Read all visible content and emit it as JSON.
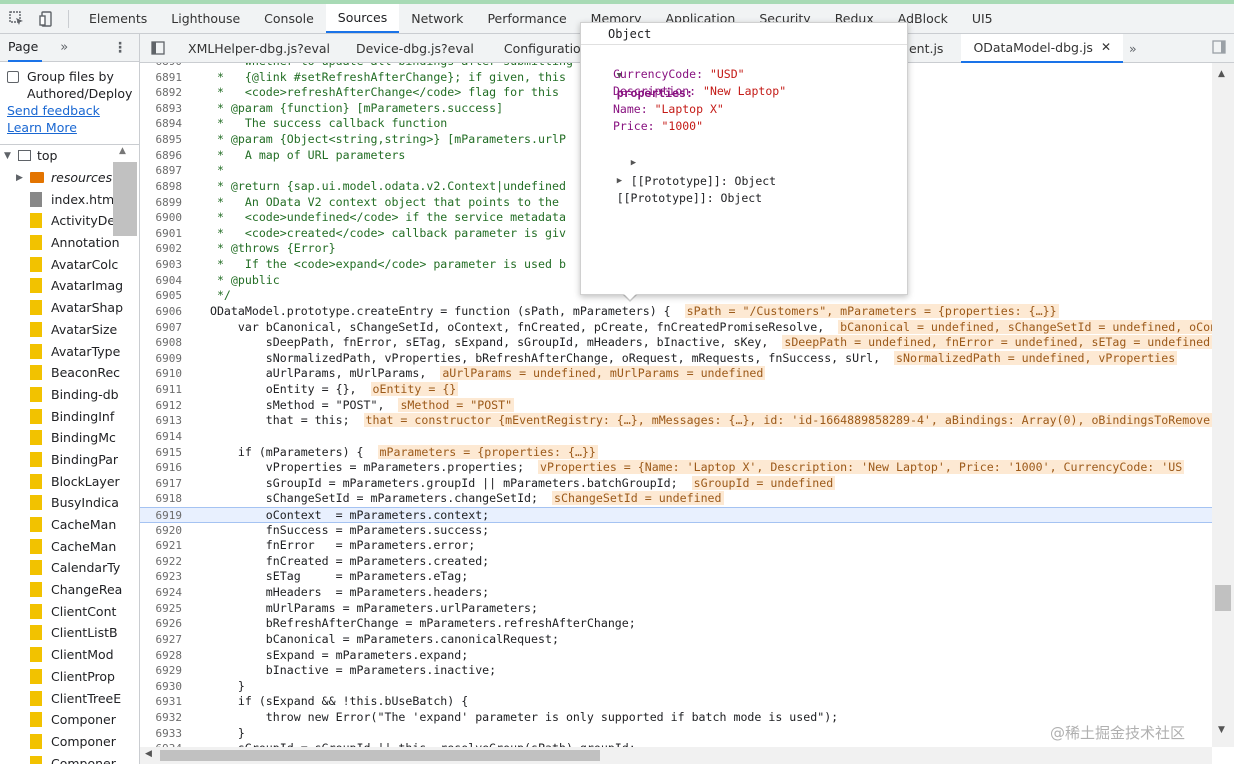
{
  "devtools_tabs": [
    "Elements",
    "Lighthouse",
    "Console",
    "Sources",
    "Network",
    "Performance",
    "Memory",
    "Application",
    "Security",
    "Redux",
    "AdBlock",
    "UI5"
  ],
  "navigator": {
    "tab": "Page",
    "group_label_1": "Group files by",
    "group_label_2": "Authored/Deploy",
    "send_feedback": "Send feedback",
    "learn_more": "Learn More",
    "tree": [
      "top",
      "resources",
      "index.html",
      "ActivityDet",
      "Annotation",
      "AvatarColc",
      "AvatarImag",
      "AvatarShap",
      "AvatarSize",
      "AvatarType",
      "BeaconRec",
      "Binding-db",
      "BindingInf",
      "BindingMc",
      "BindingPar",
      "BlockLayer",
      "BusyIndica",
      "CacheMan",
      "CacheMan",
      "CalendarTy",
      "ChangeRea",
      "ClientCont",
      "ClientListB",
      "ClientMod",
      "ClientProp",
      "ClientTreeE",
      "Componer",
      "Componer",
      "Componer"
    ]
  },
  "file_tabs": [
    "XMLHelper-dbg.js?eval",
    "Device-dbg.js?eval",
    "Configuration-dbg",
    "ent.js",
    "ODataModel-dbg.js"
  ],
  "code_lines": [
    {
      "n": "6890",
      "t": "   *   whether to update all bindings after submitting"
    },
    {
      "n": "6891",
      "t": "   *   {@link #setRefreshAfterChange}; if given, this"
    },
    {
      "n": "6892",
      "t": "   *   <code>refreshAfterChange</code> flag for this"
    },
    {
      "n": "6893",
      "t": "   * @param {function} [mParameters.success]"
    },
    {
      "n": "6894",
      "t": "   *   The success callback function"
    },
    {
      "n": "6895",
      "t": "   * @param {Object<string,string>} [mParameters.urlP"
    },
    {
      "n": "6896",
      "t": "   *   A map of URL parameters"
    },
    {
      "n": "6897",
      "t": "   *"
    },
    {
      "n": "6898",
      "t": "   * @return {sap.ui.model.odata.v2.Context|undefined"
    },
    {
      "n": "6899",
      "t": "   *   An OData V2 context object that points to the"
    },
    {
      "n": "6900",
      "t": "   *   <code>undefined</code> if the service metadata"
    },
    {
      "n": "6901",
      "t": "   *   <code>created</code> callback parameter is giv"
    },
    {
      "n": "6902",
      "t": "   * @throws {Error}"
    },
    {
      "n": "6903",
      "t": "   *   If the <code>expand</code> parameter is used b"
    },
    {
      "n": "6904",
      "t": "   * @public"
    },
    {
      "n": "6905",
      "t": "   */"
    },
    {
      "n": "6906",
      "t": "  ODataModel.prototype.createEntry = function (sPath, mParameters) {",
      "inl": "sPath = \"/Customers\", mParameters = {properties: {…}}"
    },
    {
      "n": "6907",
      "t": "      var bCanonical, sChangeSetId, oContext, fnCreated, pCreate, fnCreatedPromiseResolve,",
      "inl": "bCanonical = undefined, sChangeSetId = undefined, oCon"
    },
    {
      "n": "6908",
      "t": "          sDeepPath, fnError, sETag, sExpand, sGroupId, mHeaders, bInactive, sKey,",
      "inl": "sDeepPath = undefined, fnError = undefined, sETag = undefined"
    },
    {
      "n": "6909",
      "t": "          sNormalizedPath, vProperties, bRefreshAfterChange, oRequest, mRequests, fnSuccess, sUrl,",
      "inl": "sNormalizedPath = undefined, vProperties"
    },
    {
      "n": "6910",
      "t": "          aUrlParams, mUrlParams,",
      "inl": "aUrlParams = undefined, mUrlParams = undefined"
    },
    {
      "n": "6911",
      "t": "          oEntity = {},",
      "inl": "oEntity = {}"
    },
    {
      "n": "6912",
      "t": "          sMethod = \"POST\",",
      "inl": "sMethod = \"POST\""
    },
    {
      "n": "6913",
      "t": "          that = this;",
      "inl": "that = constructor {mEventRegistry: {…}, mMessages: {…}, id: 'id-1664889858289-4', aBindings: Array(0), oBindingsToRemove"
    },
    {
      "n": "6914",
      "t": ""
    },
    {
      "n": "6915",
      "t": "      if (mParameters) {",
      "inl": "mParameters = {properties: {…}}"
    },
    {
      "n": "6916",
      "t": "          vProperties = mParameters.properties;",
      "inl": "vProperties = {Name: 'Laptop X', Description: 'New Laptop', Price: '1000', CurrencyCode: 'US"
    },
    {
      "n": "6917",
      "t": "          sGroupId = mParameters.groupId || mParameters.batchGroupId;",
      "inl": "sGroupId = undefined"
    },
    {
      "n": "6918",
      "t": "          sChangeSetId = mParameters.changeSetId;",
      "inl": "sChangeSetId = undefined"
    },
    {
      "n": "6919",
      "t": "          oContext  = mParameters.context;"
    },
    {
      "n": "6920",
      "t": "          fnSuccess = mParameters.success;"
    },
    {
      "n": "6921",
      "t": "          fnError   = mParameters.error;"
    },
    {
      "n": "6922",
      "t": "          fnCreated = mParameters.created;"
    },
    {
      "n": "6923",
      "t": "          sETag     = mParameters.eTag;"
    },
    {
      "n": "6924",
      "t": "          mHeaders  = mParameters.headers;"
    },
    {
      "n": "6925",
      "t": "          mUrlParams = mParameters.urlParameters;"
    },
    {
      "n": "6926",
      "t": "          bRefreshAfterChange = mParameters.refreshAfterChange;"
    },
    {
      "n": "6927",
      "t": "          bCanonical = mParameters.canonicalRequest;"
    },
    {
      "n": "6928",
      "t": "          sExpand = mParameters.expand;"
    },
    {
      "n": "6929",
      "t": "          bInactive = mParameters.inactive;"
    },
    {
      "n": "6930",
      "t": "      }"
    },
    {
      "n": "6931",
      "t": "      if (sExpand && !this.bUseBatch) {"
    },
    {
      "n": "6932",
      "t": "          throw new Error(\"The 'expand' parameter is only supported if batch mode is used\");"
    },
    {
      "n": "6933",
      "t": "      }"
    },
    {
      "n": "6934",
      "t": "      sGroupId = sGroupId || this._resolveGroup(sPath).groupId;"
    }
  ],
  "popover": {
    "title": "Object",
    "properties_label": "properties:",
    "props": [
      {
        "k": "CurrencyCode:",
        "v": "\"USD\""
      },
      {
        "k": "Description:",
        "v": "\"New Laptop\""
      },
      {
        "k": "Name:",
        "v": "\"Laptop X\""
      },
      {
        "k": "Price:",
        "v": "\"1000\""
      }
    ],
    "proto_inner": "[[Prototype]]: Object",
    "proto_outer": "[[Prototype]]: Object"
  },
  "watermark": "@稀土掘金技术社区"
}
